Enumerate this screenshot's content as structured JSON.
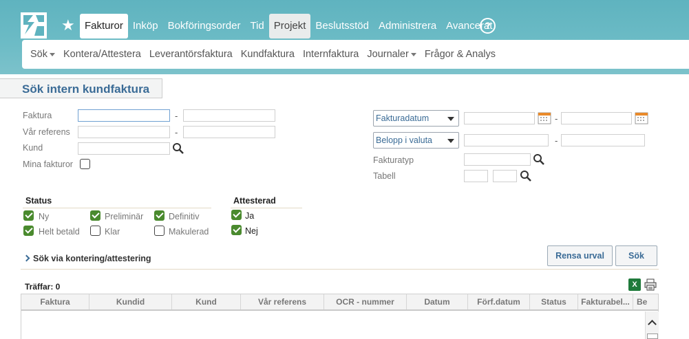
{
  "topnav": {
    "items": [
      {
        "label": "Fakturor"
      },
      {
        "label": "Inköp"
      },
      {
        "label": "Bokföringsorder"
      },
      {
        "label": "Tid"
      },
      {
        "label": "Projekt"
      },
      {
        "label": "Beslutsstöd"
      },
      {
        "label": "Administrera"
      },
      {
        "label": "Avancerat"
      }
    ],
    "help": "?"
  },
  "subnav": {
    "items": [
      {
        "label": "Sök"
      },
      {
        "label": "Kontera/Attestera"
      },
      {
        "label": "Leverantörsfaktura"
      },
      {
        "label": "Kundfaktura"
      },
      {
        "label": "Internfaktura"
      },
      {
        "label": "Journaler"
      },
      {
        "label": "Frågor & Analys"
      }
    ]
  },
  "page": {
    "title": "Sök intern kundfaktura"
  },
  "form": {
    "faktura": "Faktura",
    "var_referens": "Vår referens",
    "kund": "Kund",
    "mina_fakturor": "Mina fakturor",
    "dash": "-",
    "datum_select": "Fakturadatum",
    "belopp_select": "Belopp i valuta",
    "fakturatyp": "Fakturatyp",
    "tabell": "Tabell"
  },
  "status": {
    "heading": "Status",
    "options": [
      {
        "label": "Ny",
        "checked": true
      },
      {
        "label": "Preliminär",
        "checked": true
      },
      {
        "label": "Definitiv",
        "checked": true
      },
      {
        "label": "Helt betald",
        "checked": true
      },
      {
        "label": "Klar",
        "checked": false
      },
      {
        "label": "Makulerad",
        "checked": false
      }
    ]
  },
  "attesterad": {
    "heading": "Attesterad",
    "options": [
      {
        "label": "Ja",
        "checked": true
      },
      {
        "label": "Nej",
        "checked": true
      }
    ]
  },
  "expander": {
    "label": "Sök via kontering/attestering"
  },
  "buttons": {
    "clear": "Rensa urval",
    "search": "Sök"
  },
  "results": {
    "hits": "Träffar: 0",
    "excel_icon": "X",
    "columns": [
      "Faktura",
      "Kundid",
      "Kund",
      "Vår referens",
      "OCR - nummer",
      "Datum",
      "Förf.datum",
      "Status",
      "Fakturabel...",
      "Be"
    ]
  }
}
